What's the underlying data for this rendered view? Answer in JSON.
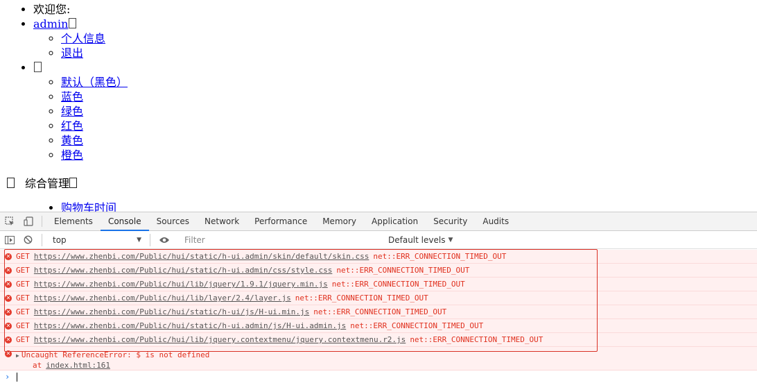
{
  "page": {
    "welcome": "欢迎您:",
    "user_link": "admin",
    "user_menu": [
      "个人信息",
      "退出"
    ],
    "skins": [
      "默认（黑色）",
      "蓝色",
      "绿色",
      "红色",
      "黄色",
      "橙色"
    ],
    "section_title": "综合管理",
    "partial_item": "购物车时间"
  },
  "devtools": {
    "tabs": [
      "Elements",
      "Console",
      "Sources",
      "Network",
      "Performance",
      "Memory",
      "Application",
      "Security",
      "Audits"
    ],
    "active_tab": "Console",
    "context": "top",
    "filter_placeholder": "Filter",
    "levels_label": "Default levels",
    "messages": [
      {
        "method": "GET",
        "url": "https://www.zhenbi.com/Public/hui/static/h-ui.admin/skin/default/skin.css",
        "error": "net::ERR_CONNECTION_TIMED_OUT"
      },
      {
        "method": "GET",
        "url": "https://www.zhenbi.com/Public/hui/static/h-ui.admin/css/style.css",
        "error": "net::ERR_CONNECTION_TIMED_OUT"
      },
      {
        "method": "GET",
        "url": "https://www.zhenbi.com/Public/hui/lib/jquery/1.9.1/jquery.min.js",
        "error": "net::ERR_CONNECTION_TIMED_OUT"
      },
      {
        "method": "GET",
        "url": "https://www.zhenbi.com/Public/hui/lib/layer/2.4/layer.js",
        "error": "net::ERR_CONNECTION_TIMED_OUT"
      },
      {
        "method": "GET",
        "url": "https://www.zhenbi.com/Public/hui/static/h-ui/js/H-ui.min.js",
        "error": "net::ERR_CONNECTION_TIMED_OUT"
      },
      {
        "method": "GET",
        "url": "https://www.zhenbi.com/Public/hui/static/h-ui.admin/js/H-ui.admin.js",
        "error": "net::ERR_CONNECTION_TIMED_OUT"
      },
      {
        "method": "GET",
        "url": "https://www.zhenbi.com/Public/hui/lib/jquery.contextmenu/jquery.contextmenu.r2.js",
        "error": "net::ERR_CONNECTION_TIMED_OUT"
      }
    ],
    "uncaught": {
      "text": "Uncaught ReferenceError: $ is not defined",
      "at_label": "at",
      "location": "index.html:161"
    },
    "colors": {
      "error_text": "#e0301e",
      "error_bg": "#fff0f0",
      "accent": "#1a73e8"
    }
  }
}
